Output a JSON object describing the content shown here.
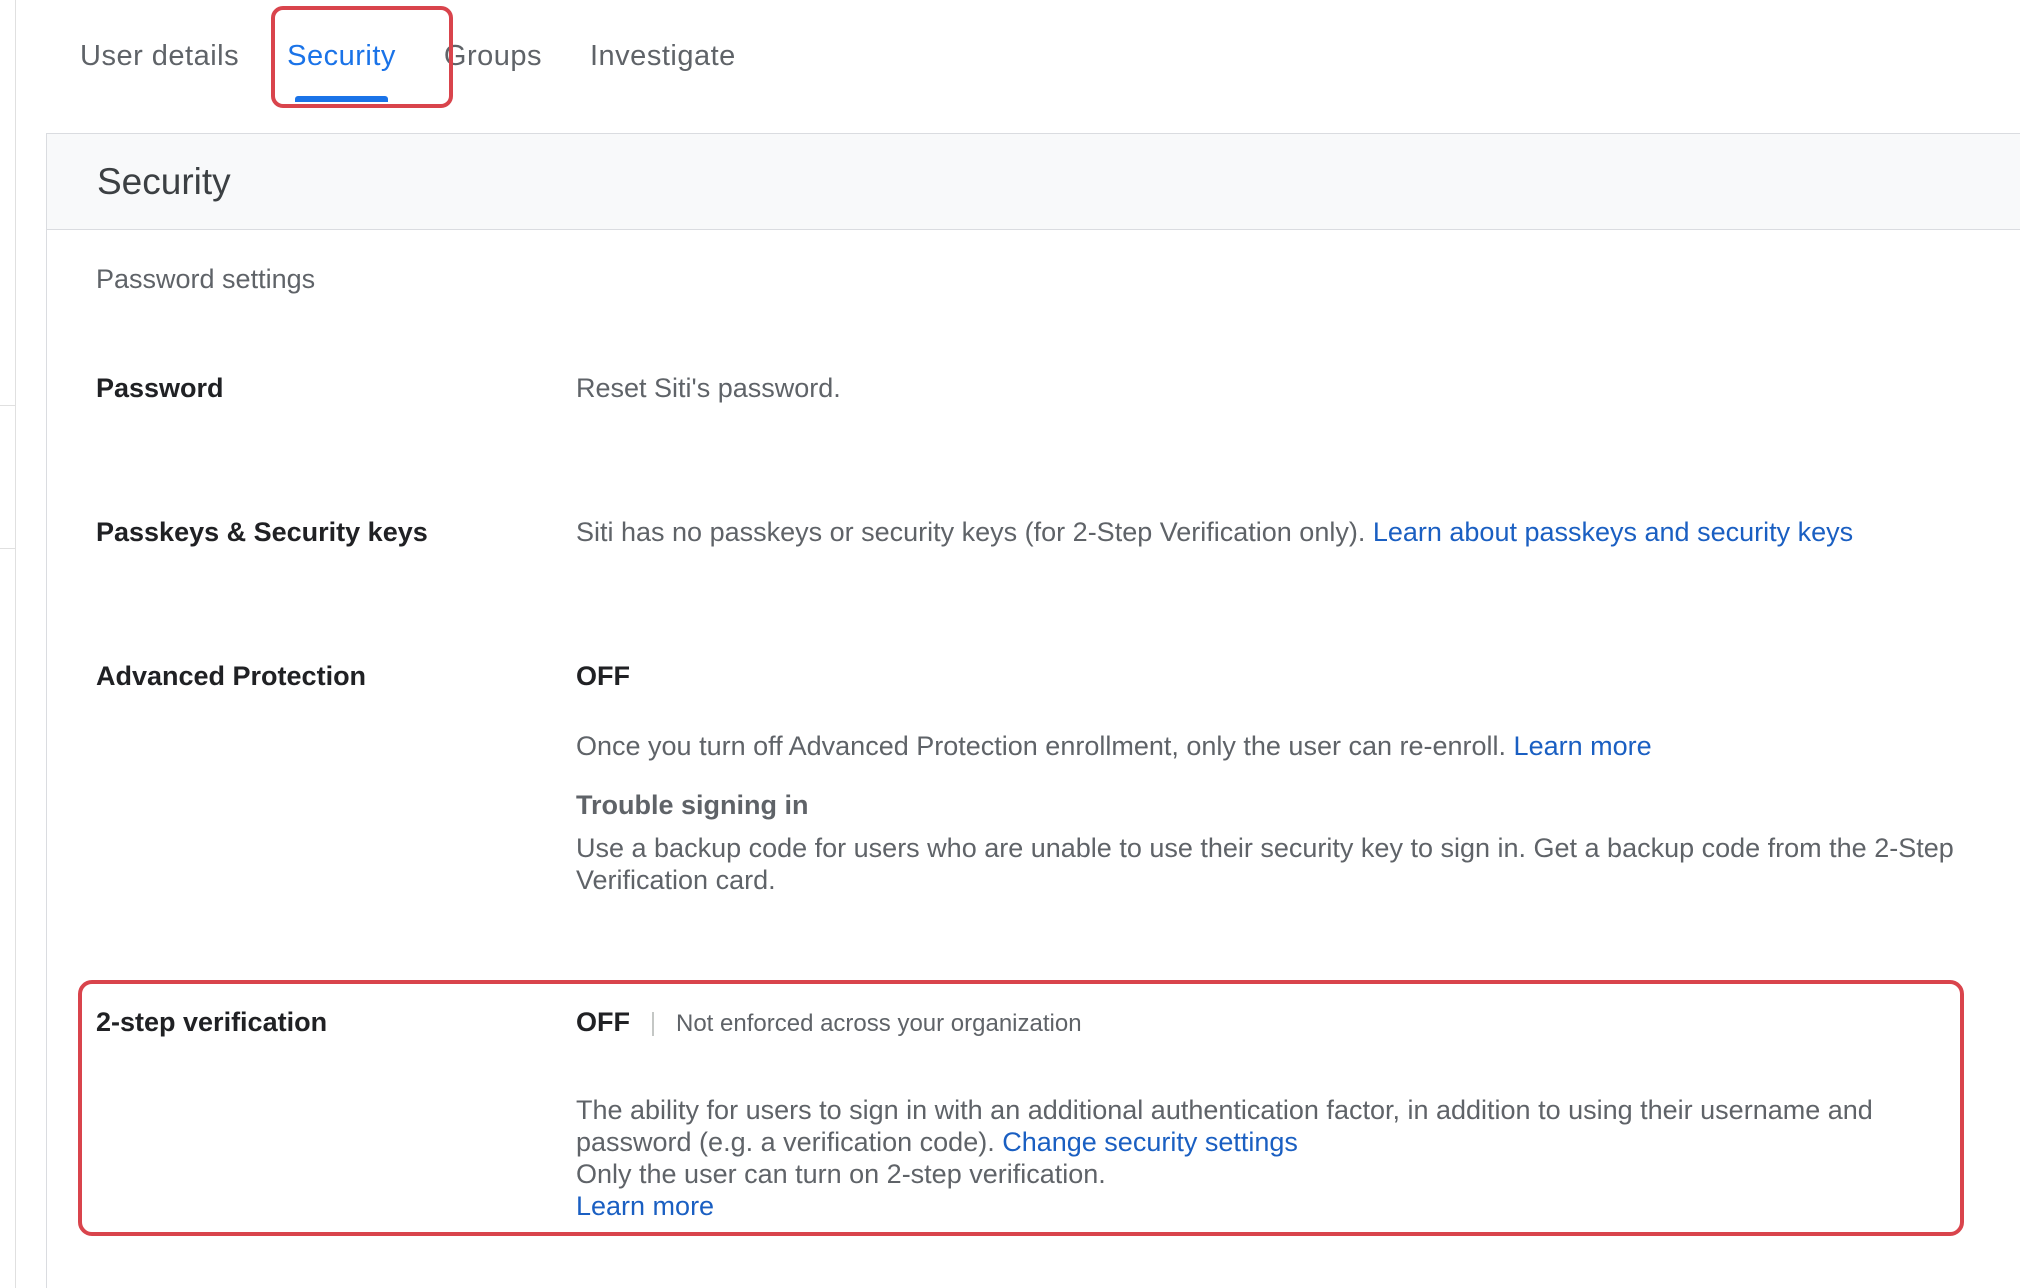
{
  "tabs": [
    {
      "label": "User details"
    },
    {
      "label": "Security"
    },
    {
      "label": "Groups"
    },
    {
      "label": "Investigate"
    }
  ],
  "card": {
    "title": "Security"
  },
  "password_settings": {
    "title": "Password settings",
    "password": {
      "label": "Password",
      "text": "Reset Siti's password."
    },
    "passkeys": {
      "label": "Passkeys & Security keys",
      "text": "Siti has no passkeys or security keys (for 2-Step Verification only).",
      "link": "Learn about passkeys and security keys"
    },
    "advanced_protection": {
      "label": "Advanced Protection",
      "status": "OFF",
      "text": "Once you turn off Advanced Protection enrollment, only the user can re-enroll.",
      "link": "Learn more",
      "trouble_title": "Trouble signing in",
      "trouble_text": "Use a backup code for users who are unable to use their security key to sign in. Get a backup code from the 2-Step Verification card."
    },
    "two_step": {
      "label": "2-step verification",
      "status": "OFF",
      "enforcement": "Not enforced across your organization",
      "text": "The ability for users to sign in with an additional authentication factor, in addition to using their username and password (e.g. a verification code).",
      "change_link": "Change security settings",
      "note": "Only the user can turn on 2-step verification.",
      "learn_more": "Learn more"
    }
  },
  "colors": {
    "accent": "#1a73e8",
    "link": "#1a5fc2",
    "highlight": "#d9444c"
  }
}
